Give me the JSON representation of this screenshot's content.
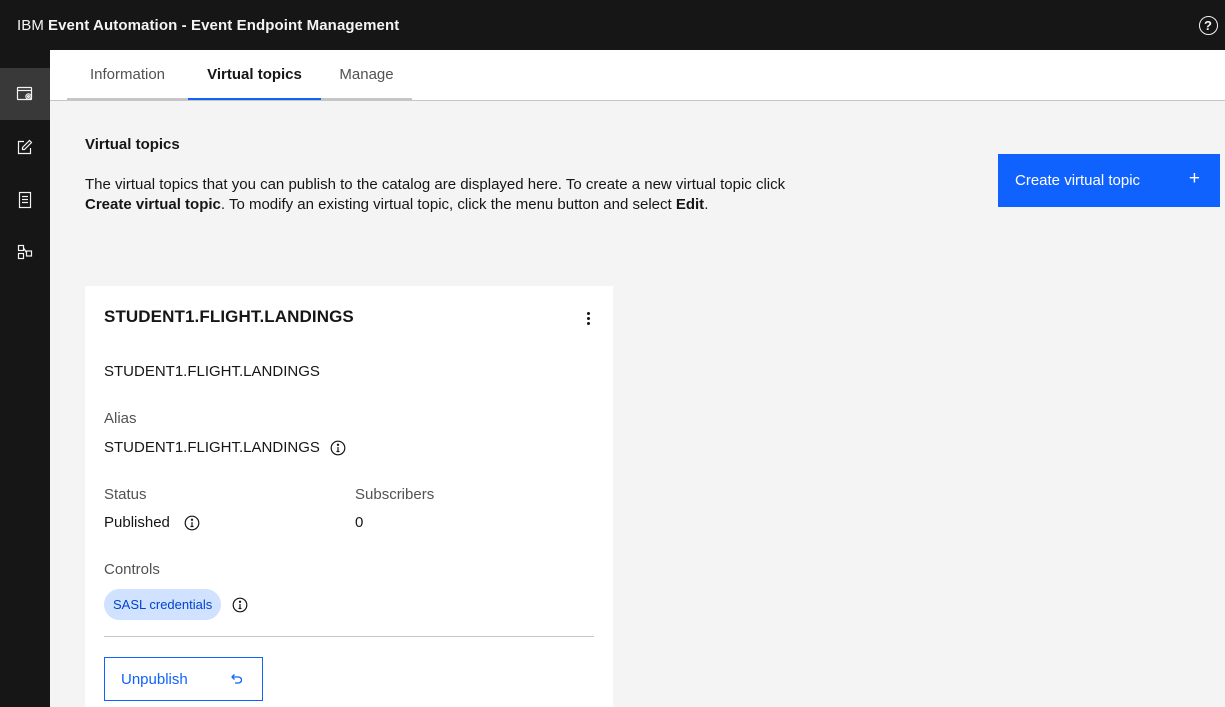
{
  "header": {
    "brand_prefix": "IBM",
    "brand_title": "Event Automation - Event Endpoint Management",
    "help_glyph": "?"
  },
  "sidenav": {
    "items": [
      {
        "icon": "catalog-settings-icon",
        "active": true
      },
      {
        "icon": "edit-icon",
        "active": false
      },
      {
        "icon": "document-icon",
        "active": false
      },
      {
        "icon": "topology-icon",
        "active": false
      }
    ]
  },
  "tabs": [
    {
      "label": "Information",
      "selected": false
    },
    {
      "label": "Virtual topics",
      "selected": true
    },
    {
      "label": "Manage",
      "selected": false
    }
  ],
  "main": {
    "section_title": "Virtual topics",
    "description": {
      "part1": "The virtual topics that you can publish to the catalog are displayed here. To create a new virtual topic click ",
      "bold1": "Create virtual topic",
      "part2": ". To modify an existing virtual topic, click the menu button and select ",
      "bold2": "Edit",
      "part3": "."
    },
    "create_button_label": "Create virtual topic",
    "create_button_icon": "+"
  },
  "card": {
    "title": "STUDENT1.FLIGHT.LANDINGS",
    "topic_name": "STUDENT1.FLIGHT.LANDINGS",
    "alias_label": "Alias",
    "alias_value": "STUDENT1.FLIGHT.LANDINGS",
    "status_label": "Status",
    "status_value": "Published",
    "subscribers_label": "Subscribers",
    "subscribers_value": "0",
    "controls_label": "Controls",
    "controls_tag": "SASL credentials",
    "unpublish_label": "Unpublish"
  },
  "colors": {
    "primary": "#0f62fe",
    "header_bg": "#161616",
    "tag_bg": "#d0e2ff",
    "tag_text": "#0043ce"
  }
}
